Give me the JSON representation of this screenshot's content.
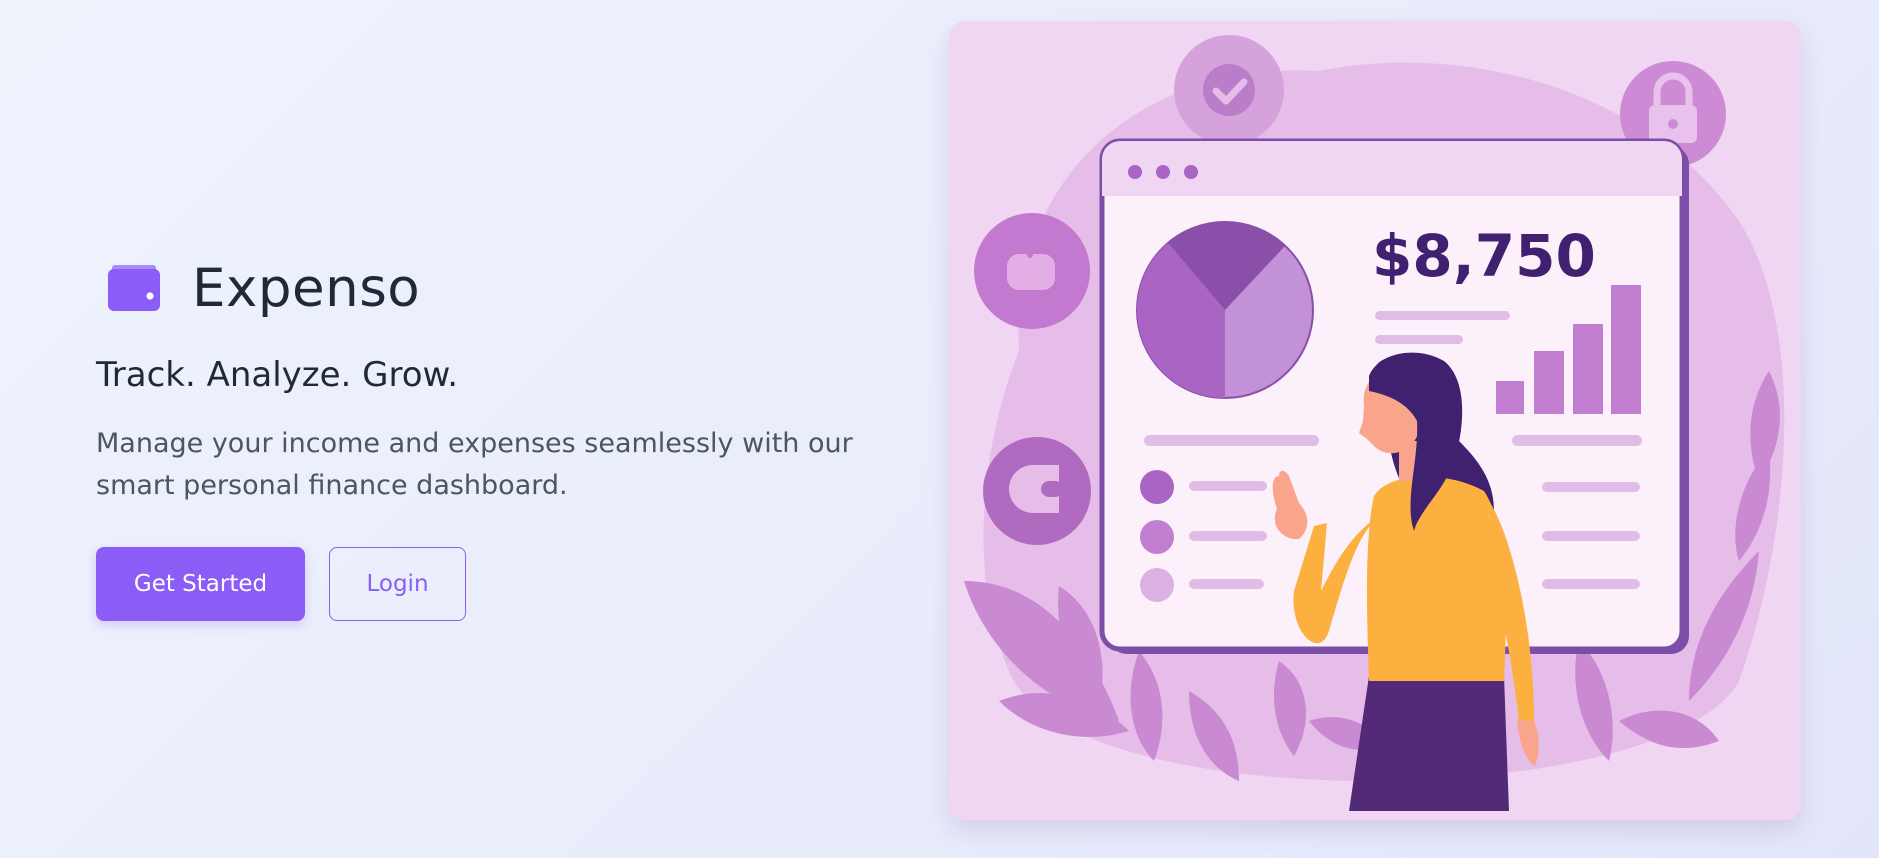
{
  "brand": {
    "name": "Expenso",
    "icon": "wallet-icon"
  },
  "hero": {
    "tagline": "Track. Analyze. Grow.",
    "description": "Manage your income and expenses seamlessly with our smart personal finance dashboard."
  },
  "actions": {
    "primary_label": "Get Started",
    "secondary_label": "Login"
  },
  "illustration": {
    "amount": "$8,750",
    "icons": [
      "check-icon",
      "lock-icon",
      "piggy-bank-icon",
      "wallet-icon"
    ]
  },
  "colors": {
    "accent": "#8b5cf6",
    "text_dark": "#1f2937",
    "text_muted": "#4b5563",
    "illustration_bg": "#f0d6f3",
    "illustration_purple": "#a964c4",
    "person_shirt": "#fbb040",
    "person_hair": "#3f2170"
  }
}
